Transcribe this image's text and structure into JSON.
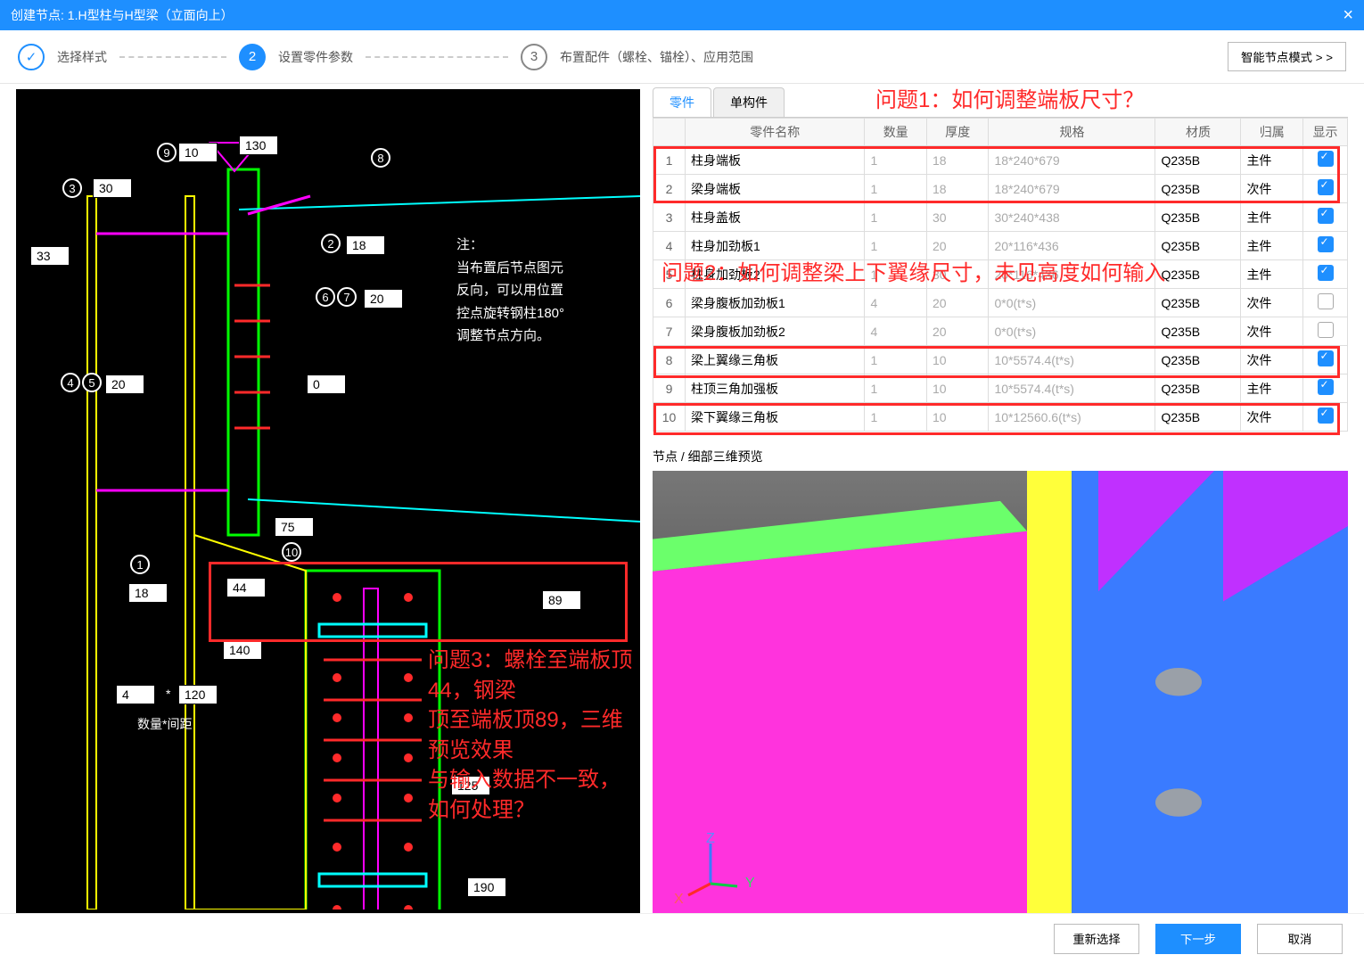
{
  "title": "创建节点: 1.H型柱与H型梁（立面向上）",
  "close": "×",
  "steps": {
    "s1": "选择样式",
    "s2": "设置零件参数",
    "s3": "布置配件（螺栓、锚栓）、应用范围",
    "num2": "2",
    "num3": "3",
    "check": "✓"
  },
  "smart_btn": "智能节点模式 > >",
  "tabs": {
    "parts": "零件",
    "single": "单构件"
  },
  "cols": {
    "name": "零件名称",
    "qty": "数量",
    "thk": "厚度",
    "spec": "规格",
    "mat": "材质",
    "own": "归属",
    "show": "显示"
  },
  "rows": [
    {
      "i": "1",
      "name": "柱身端板",
      "qty": "1",
      "thk": "18",
      "spec": "18*240*679",
      "mat": "Q235B",
      "own": "主件",
      "show": true
    },
    {
      "i": "2",
      "name": "梁身端板",
      "qty": "1",
      "thk": "18",
      "spec": "18*240*679",
      "mat": "Q235B",
      "own": "次件",
      "show": true
    },
    {
      "i": "3",
      "name": "柱身盖板",
      "qty": "1",
      "thk": "30",
      "spec": "30*240*438",
      "mat": "Q235B",
      "own": "主件",
      "show": true
    },
    {
      "i": "4",
      "name": "柱身加劲板1",
      "qty": "1",
      "thk": "20",
      "spec": "20*116*436",
      "mat": "Q235B",
      "own": "主件",
      "show": true
    },
    {
      "i": "5",
      "name": "柱身加劲板2",
      "qty": "1",
      "thk": "30",
      "spec": "20*116*436",
      "mat": "Q235B",
      "own": "主件",
      "show": true
    },
    {
      "i": "6",
      "name": "梁身腹板加劲板1",
      "qty": "4",
      "thk": "20",
      "spec": "0*0(t*s)",
      "mat": "Q235B",
      "own": "次件",
      "show": false
    },
    {
      "i": "7",
      "name": "梁身腹板加劲板2",
      "qty": "4",
      "thk": "20",
      "spec": "0*0(t*s)",
      "mat": "Q235B",
      "own": "次件",
      "show": false
    },
    {
      "i": "8",
      "name": "梁上翼缘三角板",
      "qty": "1",
      "thk": "10",
      "spec": "10*5574.4(t*s)",
      "mat": "Q235B",
      "own": "次件",
      "show": true
    },
    {
      "i": "9",
      "name": "柱顶三角加强板",
      "qty": "1",
      "thk": "10",
      "spec": "10*5574.4(t*s)",
      "mat": "Q235B",
      "own": "主件",
      "show": true
    },
    {
      "i": "10",
      "name": "梁下翼缘三角板",
      "qty": "1",
      "thk": "10",
      "spec": "10*12560.6(t*s)",
      "mat": "Q235B",
      "own": "次件",
      "show": true
    }
  ],
  "preview_title": "节点 / 细部三维预览",
  "footer": {
    "reselect": "重新选择",
    "next": "下一步",
    "cancel": "取消"
  },
  "q1": "问题1：如何调整端板尺寸？",
  "q2": "问题2：如何调整梁上下翼缘尺寸，未见高度如何输入",
  "q3a": "问题3：螺栓至端板顶44，钢梁",
  "q3b": "顶至端板顶89，三维预览效果",
  "q3c": "与输入数据不一致，如何处理？",
  "note": {
    "l0": "注：",
    "l1": "当布置后节点图元",
    "l2": "反向，可以用位置",
    "l3": "控点旋转钢柱180°",
    "l4": "调整节点方向。"
  },
  "dims": {
    "d130": "130",
    "d10": "10",
    "d30": "30",
    "d33": "33",
    "d18": "18",
    "d20_1": "20",
    "d20_2": "20",
    "d0": "0",
    "d75": "75",
    "d44": "44",
    "d89": "89",
    "d18b": "18",
    "d140": "140",
    "d4": "4",
    "d120": "120",
    "d125": "125",
    "d190": "190",
    "mul": "*"
  },
  "qty_lbl": "数量*间距",
  "marks": {
    "m1": "1",
    "m2": "2",
    "m3": "3",
    "m4": "4",
    "m5": "5",
    "m6": "6",
    "m7": "7",
    "m8": "8",
    "m9": "9",
    "m10": "10"
  },
  "axes": {
    "x": "X",
    "y": "Y",
    "z": "Z"
  }
}
